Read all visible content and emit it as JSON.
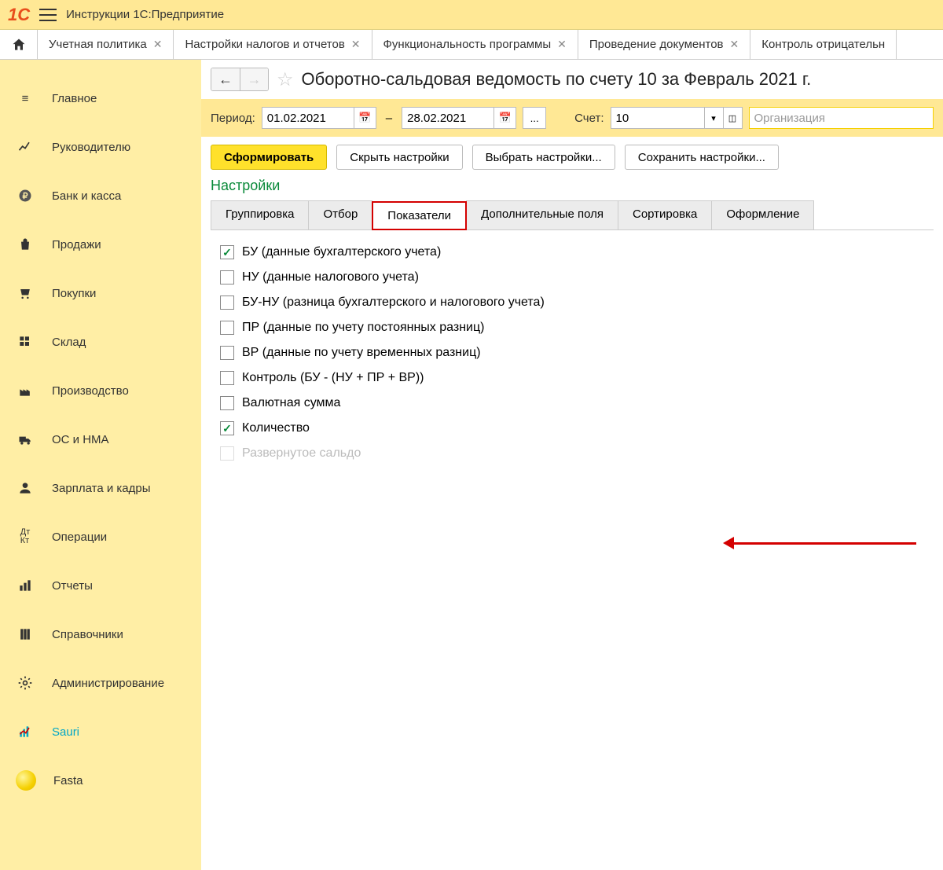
{
  "app": {
    "title": "Инструкции 1С:Предприятие"
  },
  "tabs": [
    {
      "label": "Учетная политика"
    },
    {
      "label": "Настройки налогов и отчетов"
    },
    {
      "label": "Функциональность программы"
    },
    {
      "label": "Проведение документов"
    },
    {
      "label": "Контроль отрицательн"
    }
  ],
  "sidebar": {
    "items": [
      {
        "label": "Главное"
      },
      {
        "label": "Руководителю"
      },
      {
        "label": "Банк и касса"
      },
      {
        "label": "Продажи"
      },
      {
        "label": "Покупки"
      },
      {
        "label": "Склад"
      },
      {
        "label": "Производство"
      },
      {
        "label": "ОС и НМА"
      },
      {
        "label": "Зарплата и кадры"
      },
      {
        "label": "Операции"
      },
      {
        "label": "Отчеты"
      },
      {
        "label": "Справочники"
      },
      {
        "label": "Администрирование"
      },
      {
        "label": "Sauri"
      },
      {
        "label": "Fasta"
      }
    ]
  },
  "page": {
    "title": "Оборотно-сальдовая ведомость по счету 10 за Февраль 2021 г.",
    "period_label": "Период:",
    "date_from": "01.02.2021",
    "date_to": "28.02.2021",
    "dots": "...",
    "account_label": "Счет:",
    "account_value": "10",
    "org_placeholder": "Организация"
  },
  "buttons": {
    "generate": "Сформировать",
    "hide": "Скрыть настройки",
    "choose": "Выбрать настройки...",
    "save": "Сохранить настройки..."
  },
  "settings": {
    "header": "Настройки",
    "tabs": [
      {
        "label": "Группировка"
      },
      {
        "label": "Отбор"
      },
      {
        "label": "Показатели"
      },
      {
        "label": "Дополнительные поля"
      },
      {
        "label": "Сортировка"
      },
      {
        "label": "Оформление"
      }
    ],
    "activeTab": 2,
    "indicators": [
      {
        "label": "БУ (данные бухгалтерского учета)",
        "checked": true,
        "disabled": false
      },
      {
        "label": "НУ (данные налогового учета)",
        "checked": false,
        "disabled": false
      },
      {
        "label": "БУ-НУ (разница бухгалтерского и налогового учета)",
        "checked": false,
        "disabled": false
      },
      {
        "label": "ПР (данные по учету постоянных разниц)",
        "checked": false,
        "disabled": false
      },
      {
        "label": "ВР (данные по учету временных разниц)",
        "checked": false,
        "disabled": false
      },
      {
        "label": "Контроль (БУ - (НУ + ПР + ВР))",
        "checked": false,
        "disabled": false
      },
      {
        "label": "Валютная сумма",
        "checked": false,
        "disabled": false
      },
      {
        "label": "Количество",
        "checked": true,
        "disabled": false
      },
      {
        "label": "Развернутое сальдо",
        "checked": false,
        "disabled": true
      }
    ]
  }
}
